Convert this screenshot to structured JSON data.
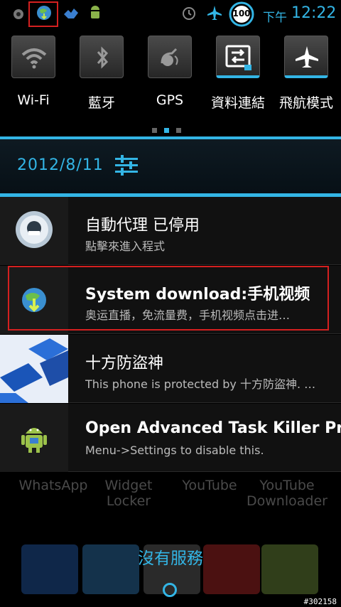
{
  "status_bar": {
    "ampm": "下午",
    "time": "12:22",
    "battery": "100",
    "icons": [
      "settings-small-icon",
      "globe-download-icon",
      "handshake-icon",
      "android-icon",
      "alarm-icon",
      "airplane-icon",
      "battery-icon"
    ]
  },
  "quick_settings": {
    "tiles": [
      {
        "label": "Wi-Fi",
        "icon": "wifi-icon"
      },
      {
        "label": "藍牙",
        "icon": "bluetooth-icon"
      },
      {
        "label": "GPS",
        "icon": "gps-icon"
      },
      {
        "label": "資料連結",
        "icon": "data-link-icon"
      },
      {
        "label": "飛航模式",
        "icon": "airplane-mode-icon"
      }
    ]
  },
  "date_row": {
    "date": "2012/8/11"
  },
  "notifications": [
    {
      "title": "自動代理 已停用",
      "text": "點擊來進入程式",
      "icon": "proxy-icon"
    },
    {
      "title": "System download:手机视频",
      "text": "奥运直播，免流量费，手机视频点击进…",
      "icon": "globe-download-icon"
    },
    {
      "title": "十方防盜神",
      "text": "This phone is protected by 十方防盜神. …",
      "icon": "cube-pattern-icon"
    },
    {
      "title": "Open Advanced Task Killer Pro",
      "text": "Menu->Settings to disable this.",
      "icon": "android-icon"
    }
  ],
  "home": {
    "apps": [
      "WhatsApp",
      "Widget\nLocker",
      "YouTube",
      "YouTube\nDownloader"
    ],
    "no_service": "沒有服務",
    "watermark": "#302158"
  },
  "colors": {
    "accent": "#33b5e5",
    "highlight": "#d42020"
  }
}
